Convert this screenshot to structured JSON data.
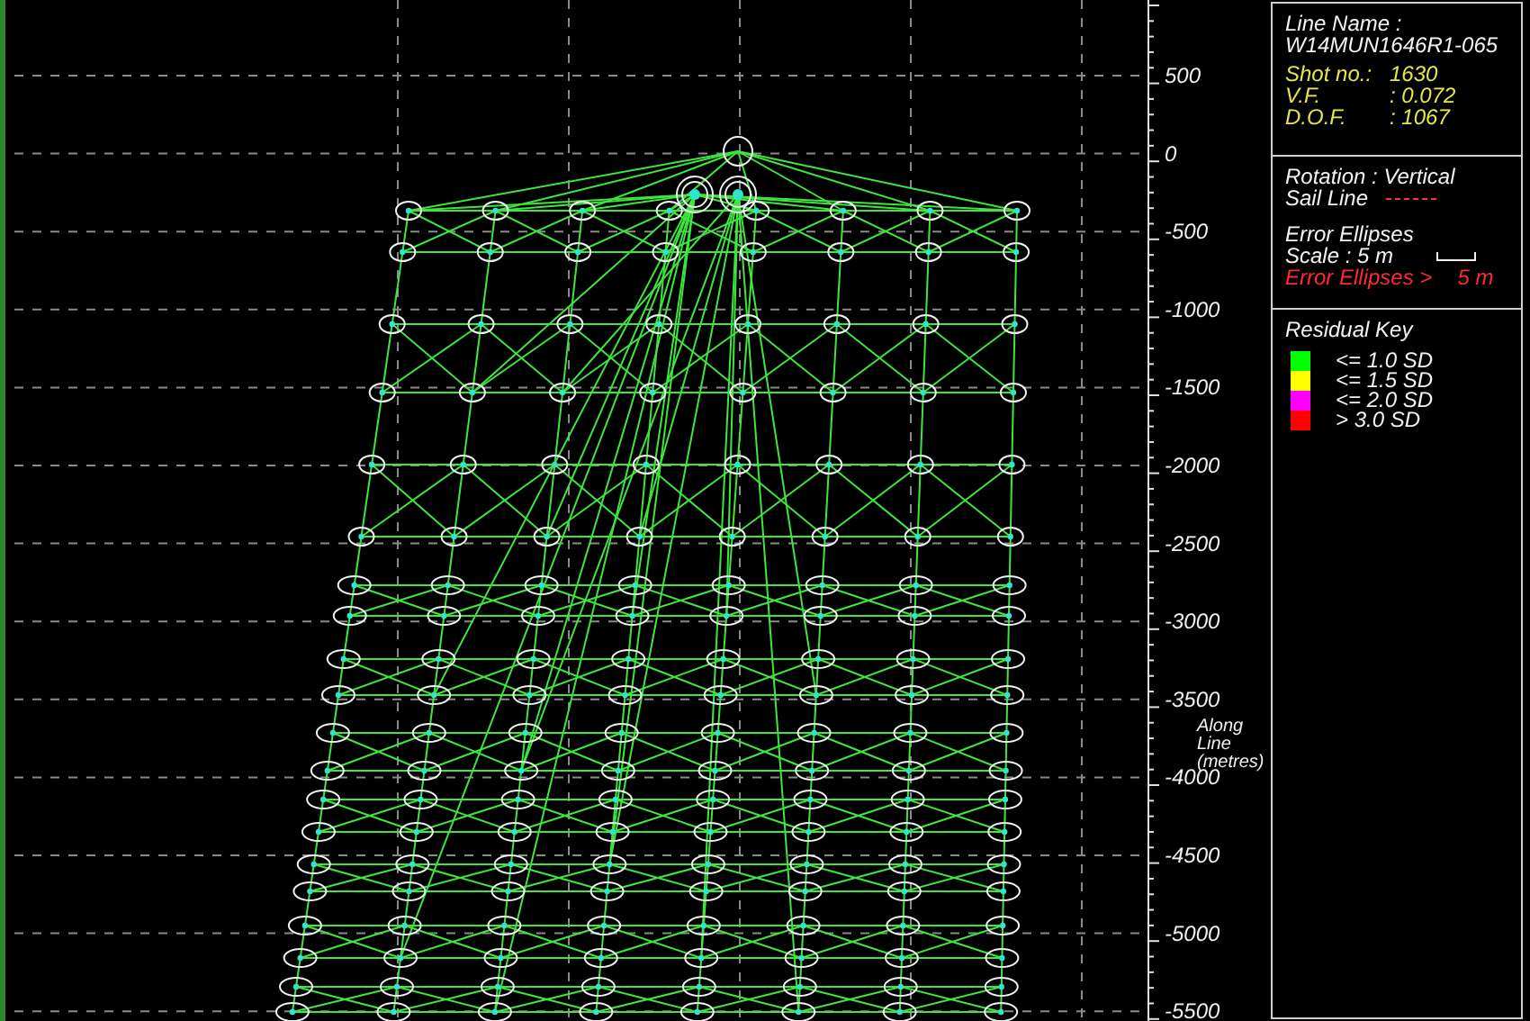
{
  "info": {
    "line_name_label": "Line Name :",
    "line_name": "W14MUN1646R1-065",
    "fields": [
      {
        "label": "Shot no.:",
        "value": "1630"
      },
      {
        "label": "V.F.",
        "value": ": 0.072"
      },
      {
        "label": "D.O.F.",
        "value": ": 1067"
      }
    ]
  },
  "display": {
    "rotation": "Rotation : Vertical",
    "sail_line": "Sail Line",
    "error_ellipses": "Error Ellipses",
    "scale": "Scale : 5 m",
    "error_warning_label": "Error Ellipses >",
    "error_warning_value": "5 m"
  },
  "residual_key": {
    "title": "Residual Key",
    "items": [
      {
        "label": "<= 1.0 SD",
        "color": "#00ff00"
      },
      {
        "label": "<= 1.5 SD",
        "color": "#ffff00"
      },
      {
        "label": "<= 2.0 SD",
        "color": "#ff00ff"
      },
      {
        "label": ">   3.0 SD",
        "color": "#ff0000"
      }
    ]
  },
  "axis": {
    "ticks": [
      "500",
      "0",
      "-500",
      "-1000",
      "-1500",
      "-2000",
      "-2500",
      "-3000",
      "-3500",
      "-4000",
      "-4500",
      "-5000",
      "-5500"
    ],
    "title": [
      "Along",
      "Line",
      "(metres)"
    ]
  }
}
